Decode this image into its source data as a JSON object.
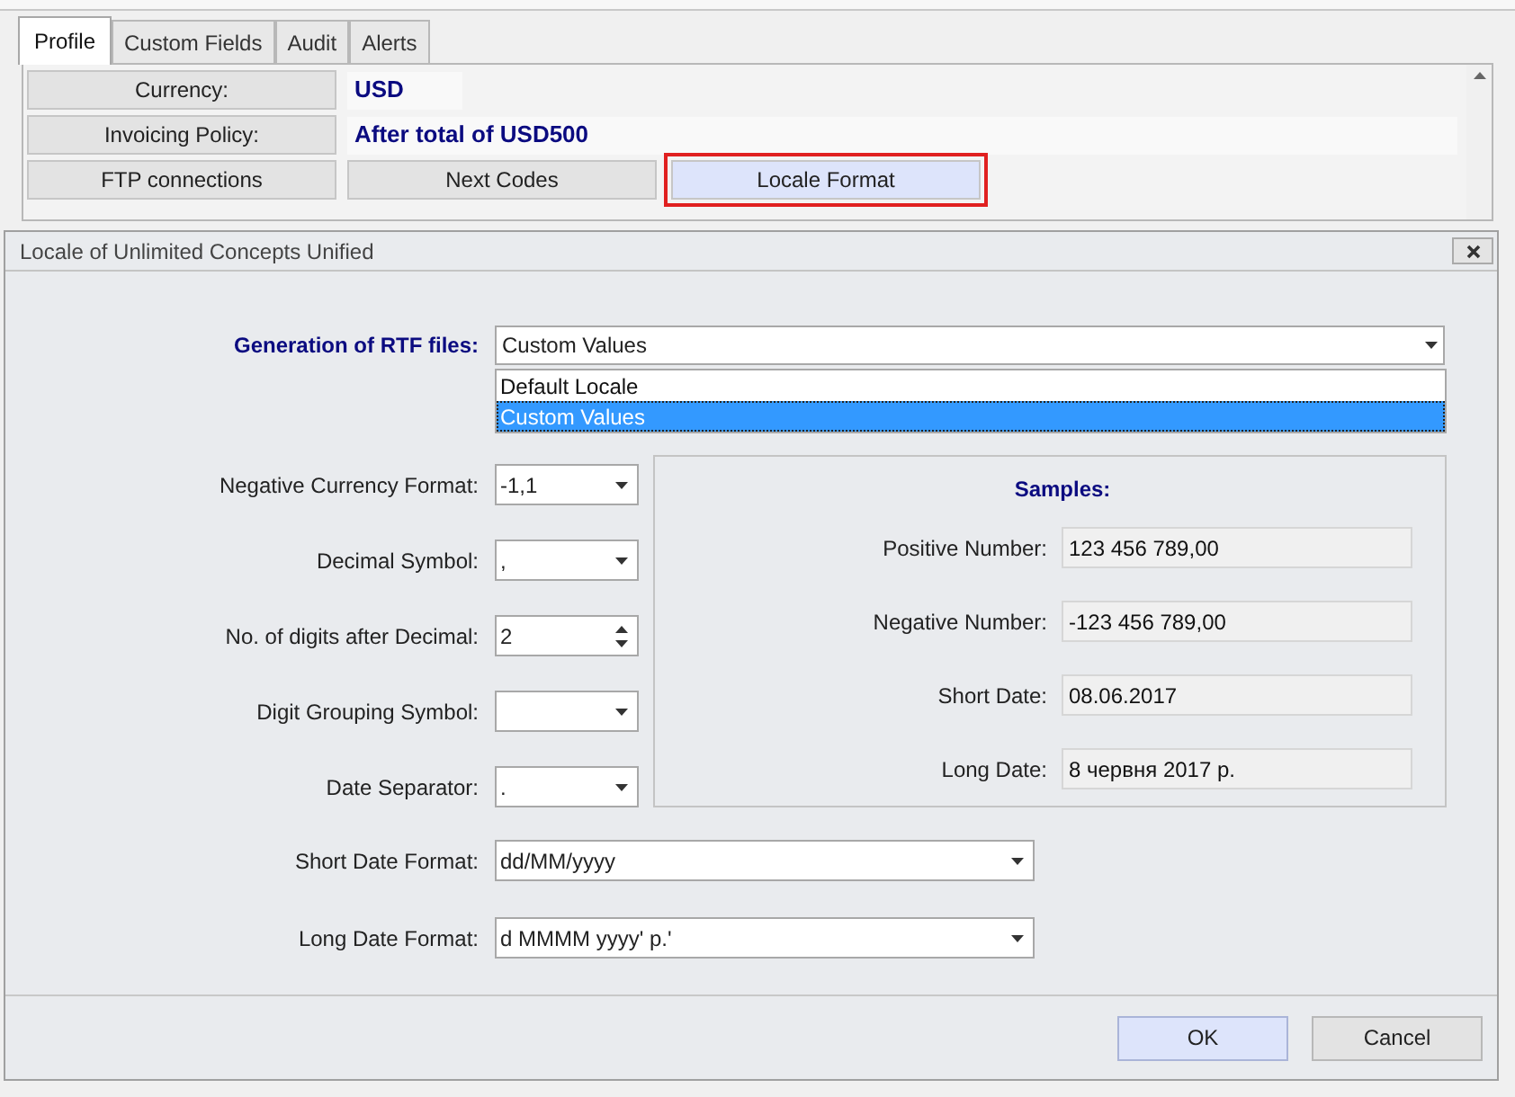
{
  "tabs": [
    {
      "label": "Profile",
      "selected": true
    },
    {
      "label": "Custom Fields",
      "selected": false
    },
    {
      "label": "Audit",
      "selected": false
    },
    {
      "label": "Alerts",
      "selected": false
    }
  ],
  "profile_rows": [
    {
      "label": "Currency:",
      "value": "USD"
    },
    {
      "label": "Invoicing Policy:",
      "value": "After total of USD500"
    }
  ],
  "profile_buttons": [
    {
      "label": "FTP connections",
      "highlighted": false
    },
    {
      "label": "Next Codes",
      "highlighted": false
    },
    {
      "label": "Locale Format",
      "highlighted": true
    }
  ],
  "dialog": {
    "title": "Locale of Unlimited Concepts Unified",
    "generation": {
      "label": "Generation of RTF files:",
      "value": "Custom Values",
      "options": [
        {
          "label": "Default Locale",
          "selected": false
        },
        {
          "label": "Custom Values",
          "selected": true
        }
      ]
    },
    "fields": [
      {
        "kind": "dropdown",
        "label": "Negative Currency Format:",
        "value": "-1,1"
      },
      {
        "kind": "dropdown",
        "label": "Decimal Symbol:",
        "value": ","
      },
      {
        "kind": "spinner",
        "label": "No. of digits after Decimal:",
        "value": "2"
      },
      {
        "kind": "dropdown",
        "label": "Digit Grouping Symbol:"
      },
      {
        "kind": "dropdown",
        "label": "Date Separator:",
        "value": "."
      }
    ],
    "samples": {
      "title": "Samples:",
      "rows": [
        {
          "label": "Positive Number:",
          "value": "123 456 789,00"
        },
        {
          "label": "Negative Number:",
          "value": "-123 456 789,00"
        },
        {
          "label": "Short Date:",
          "value": "08.06.2017"
        },
        {
          "label": "Long Date:",
          "value": "8 червня 2017 р."
        }
      ]
    },
    "date_formats": [
      {
        "label": "Short Date Format:",
        "value": "dd/MM/yyyy"
      },
      {
        "label": "Long Date Format:",
        "value": "d MMMM yyyy' р.'"
      }
    ],
    "buttons": [
      {
        "label": "OK",
        "default": true
      },
      {
        "label": "Cancel",
        "default": false
      }
    ]
  }
}
